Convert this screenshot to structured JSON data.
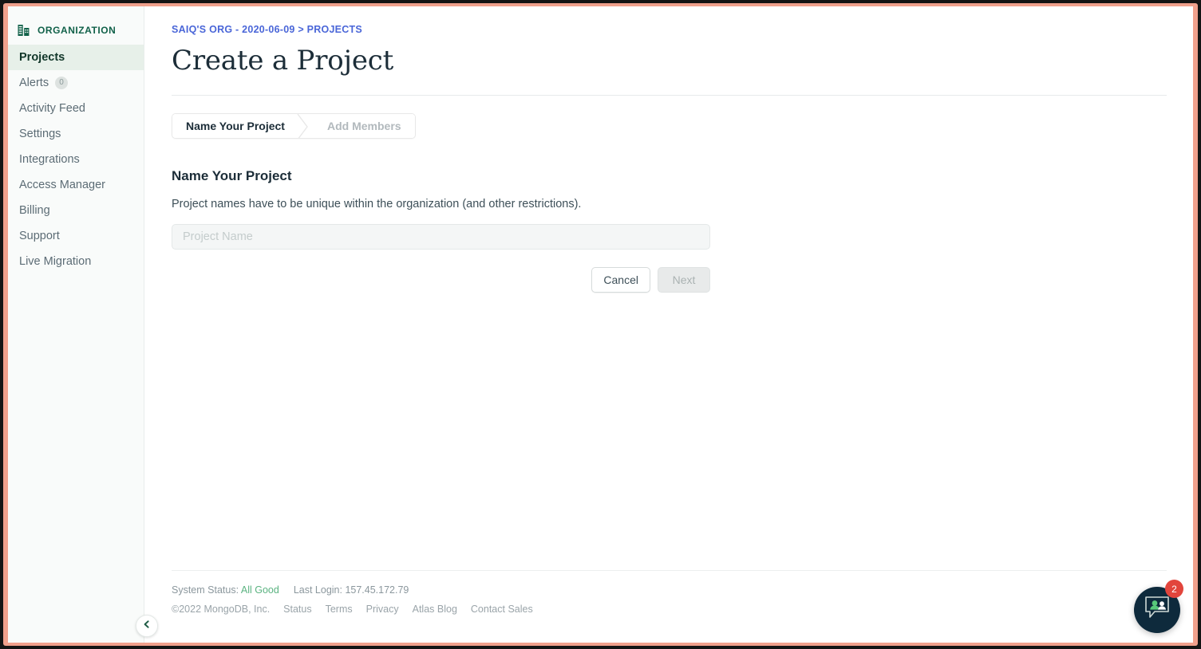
{
  "sidebar": {
    "org_icon": "building-icon",
    "org_label": "ORGANIZATION",
    "items": [
      {
        "label": "Projects",
        "badge": null,
        "active": true
      },
      {
        "label": "Alerts",
        "badge": "0",
        "active": false
      },
      {
        "label": "Activity Feed",
        "badge": null,
        "active": false
      },
      {
        "label": "Settings",
        "badge": null,
        "active": false
      },
      {
        "label": "Integrations",
        "badge": null,
        "active": false
      },
      {
        "label": "Access Manager",
        "badge": null,
        "active": false
      },
      {
        "label": "Billing",
        "badge": null,
        "active": false
      },
      {
        "label": "Support",
        "badge": null,
        "active": false
      },
      {
        "label": "Live Migration",
        "badge": null,
        "active": false
      }
    ],
    "collapse_icon": "chevron-left-icon"
  },
  "header": {
    "breadcrumb": "SAIQ'S ORG - 2020-06-09 > PROJECTS",
    "title": "Create a Project"
  },
  "stepper": {
    "steps": [
      {
        "label": "Name Your Project",
        "state": "current"
      },
      {
        "label": "Add Members",
        "state": "upcoming"
      }
    ]
  },
  "form": {
    "section_title": "Name Your Project",
    "description": "Project names have to be unique within the organization (and other restrictions).",
    "project_name_value": "",
    "project_name_placeholder": "Project Name",
    "cancel_label": "Cancel",
    "next_label": "Next",
    "next_disabled": true
  },
  "footer": {
    "system_status_label": "System Status:",
    "system_status_value": "All Good",
    "last_login": "Last Login: 157.45.172.79",
    "copyright": "©2022 MongoDB, Inc.",
    "links": [
      "Status",
      "Terms",
      "Privacy",
      "Atlas Blog",
      "Contact Sales"
    ]
  },
  "chat": {
    "icon": "chat-people-icon",
    "badge_count": "2"
  },
  "colors": {
    "accent_green": "#116149",
    "active_nav_bg": "#e7f0e9",
    "breadcrumb_blue": "#4a66d8",
    "status_good": "#5bb381",
    "chat_bg": "#0e2a3c",
    "badge_red": "#e2453c",
    "frame_coral": "#f0a08c"
  }
}
